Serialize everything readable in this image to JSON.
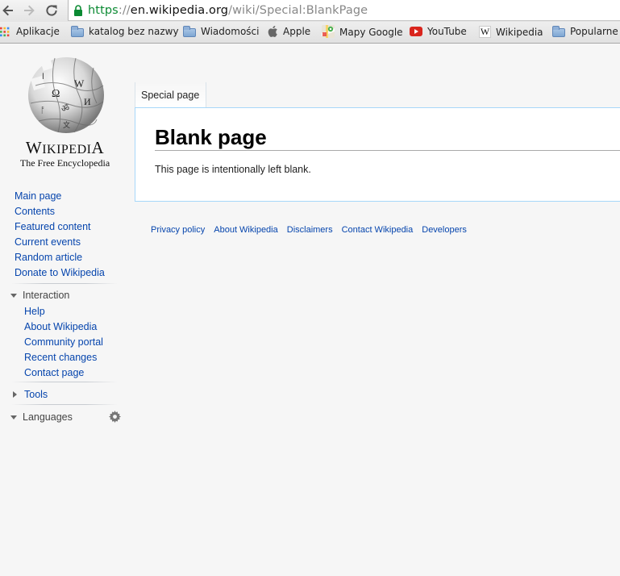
{
  "browser": {
    "url_scheme": "https",
    "url_sep": "://",
    "url_host": "en.wikipedia.org",
    "url_path": "/wiki/Special:BlankPage",
    "bookmarks": [
      {
        "label": "Aplikacje",
        "icon": "apps-grid-icon"
      },
      {
        "label": "katalog bez nazwy",
        "icon": "folder-icon"
      },
      {
        "label": "Wiadomości",
        "icon": "folder-icon"
      },
      {
        "label": "Apple",
        "icon": "apple-icon"
      },
      {
        "label": "Mapy Google",
        "icon": "google-maps-icon"
      },
      {
        "label": "YouTube",
        "icon": "youtube-icon"
      },
      {
        "label": "Wikipedia",
        "icon": "wikipedia-icon"
      },
      {
        "label": "Popularne",
        "icon": "folder-icon"
      }
    ]
  },
  "logo": {
    "name_first": "W",
    "name_mid": "IKIPEDI",
    "name_last": "A",
    "tagline": "The Free Encyclopedia"
  },
  "sidebar": {
    "main": [
      "Main page",
      "Contents",
      "Featured content",
      "Current events",
      "Random article",
      "Donate to Wikipedia"
    ],
    "interaction_heading": "Interaction",
    "interaction": [
      "Help",
      "About Wikipedia",
      "Community portal",
      "Recent changes",
      "Contact page"
    ],
    "tools_heading": "Tools",
    "languages_heading": "Languages"
  },
  "tab_label": "Special page",
  "page": {
    "title": "Blank page",
    "body": "This page is intentionally left blank."
  },
  "footer": [
    "Privacy policy",
    "About Wikipedia",
    "Disclaimers",
    "Contact Wikipedia",
    "Developers"
  ],
  "colors": {
    "link": "#0645ad",
    "content_border": "#a7d7f9",
    "secure_green": "#0b8a33"
  }
}
